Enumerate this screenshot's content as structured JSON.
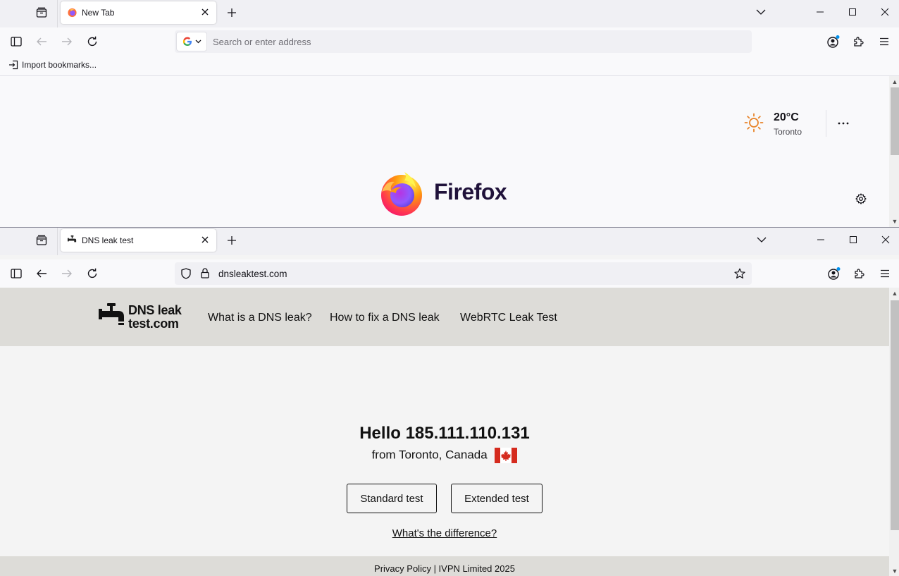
{
  "window1": {
    "tab": {
      "title": "New Tab"
    },
    "urlbar": {
      "placeholder": "Search or enter address"
    },
    "bookmarks": {
      "import_label": "Import bookmarks..."
    },
    "newtab": {
      "weather": {
        "temp": "20°C",
        "city": "Toronto"
      },
      "brand": "Firefox"
    }
  },
  "window2": {
    "tab": {
      "title": "DNS leak test"
    },
    "urlbar": {
      "url": "dnsleaktest.com"
    },
    "site": {
      "logo_line1": "DNS leak",
      "logo_line2": "test.com",
      "nav": [
        "What is a DNS leak?",
        "How to fix a DNS leak",
        "WebRTC Leak Test"
      ],
      "hello": "Hello 185.111.110.131",
      "from": "from Toronto, Canada",
      "buttons": {
        "standard": "Standard test",
        "extended": "Extended test"
      },
      "difference_link": "What's the difference?",
      "footer": "Privacy Policy | IVPN Limited 2025"
    }
  },
  "colors": {
    "chrome_bg": "#f0f0f4",
    "site_header_bg": "#dddcd8",
    "page_bg": "#f4f4f4",
    "weather_sun": "#e8842a",
    "extension_badge": "#0090ed"
  }
}
